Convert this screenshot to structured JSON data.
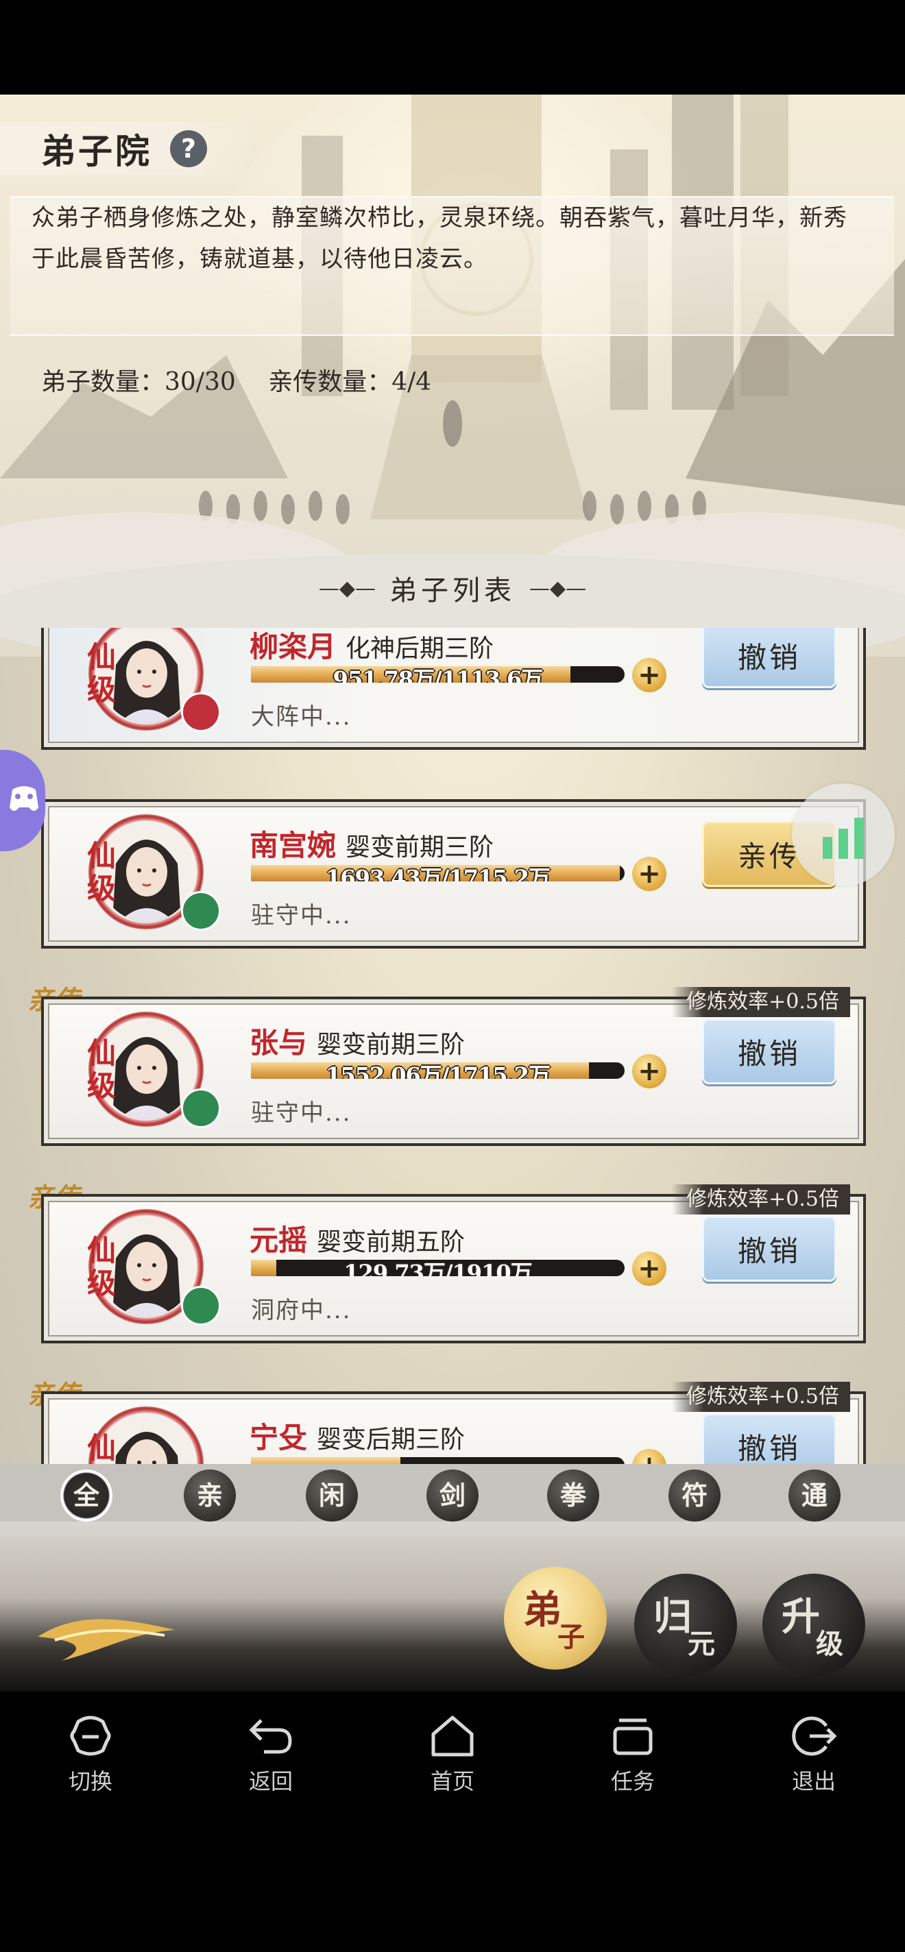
{
  "panel": {
    "title": "弟子院",
    "help": "?",
    "description": "众弟子栖身修炼之处，静室鳞次栉比，灵泉环绕。朝吞紫气，暮吐月华，新秀于此晨昏苦修，铸就道基，以待他日凌云。",
    "stats": {
      "disciple_count": "弟子数量：30/30",
      "inner_count": "亲传数量：4/4"
    },
    "list_header": "弟子列表"
  },
  "disciples": [
    {
      "grade": "仙级",
      "name": "柳栥月",
      "realm": "化神后期三阶",
      "progress_text": "951.78万/1113.6万",
      "progress": 0.855,
      "status": "大阵中...",
      "action": "撤销",
      "action_style": "blue",
      "inner": false,
      "element_color": "#c0303a"
    },
    {
      "grade": "仙级",
      "name": "南宫婉",
      "realm": "婴变前期三阶",
      "progress_text": "1693.43万/1715.2万",
      "progress": 0.987,
      "status": "驻守中...",
      "action": "亲传",
      "action_style": "gold",
      "inner": false,
      "element_color": "#2f8a52"
    },
    {
      "grade": "仙级",
      "name": "张与",
      "realm": "婴变前期三阶",
      "progress_text": "1552.06万/1715.2万",
      "progress": 0.905,
      "status": "驻守中...",
      "action": "撤销",
      "action_style": "blue",
      "inner": true,
      "inner_tag": "亲传",
      "bonus": "修炼效率+0.5倍",
      "element_color": "#2f8a52"
    },
    {
      "grade": "仙级",
      "name": "元摇",
      "realm": "婴变前期五阶",
      "progress_text": "129.73万/1910万",
      "progress": 0.068,
      "status": "洞府中...",
      "action": "撤销",
      "action_style": "blue",
      "inner": true,
      "inner_tag": "亲传",
      "bonus": "修炼效率+0.5倍",
      "element_color": "#2f8a52"
    },
    {
      "grade": "仙级",
      "name": "宁殳",
      "realm": "婴变后期三阶",
      "progress_text": "",
      "progress": 0.4,
      "status": "",
      "action": "撤销",
      "action_style": "blue",
      "inner": true,
      "inner_tag": "亲传",
      "bonus": "修炼效率+0.5倍",
      "element_color": "#2f8a52"
    }
  ],
  "filters": [
    "全",
    "亲",
    "闲",
    "剑",
    "拳",
    "符",
    "通"
  ],
  "filter_active": 0,
  "bottom_buttons": {
    "disciple": {
      "t1": "弟",
      "t2": "子"
    },
    "guiyuan": {
      "t1": "归",
      "t2": "元"
    },
    "shengji": {
      "t1": "升",
      "t2": "级"
    }
  },
  "nav": [
    {
      "label": "切换",
      "icon": "switch-icon"
    },
    {
      "label": "返回",
      "icon": "back-icon"
    },
    {
      "label": "首页",
      "icon": "home-icon"
    },
    {
      "label": "任务",
      "icon": "tasks-icon"
    },
    {
      "label": "退出",
      "icon": "exit-icon"
    }
  ]
}
